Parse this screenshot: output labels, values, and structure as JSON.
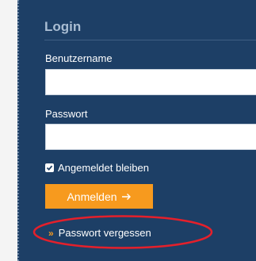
{
  "login": {
    "title": "Login",
    "username_label": "Benutzername",
    "username_value": "",
    "password_label": "Passwort",
    "password_value": "",
    "remember_label": "Angemeldet bleiben",
    "remember_checked": true,
    "submit_label": "Anmelden",
    "submit_icon": "arrow-right-icon",
    "forgot_label": "Passwort vergessen",
    "forgot_icon": "double-chevron-right-icon"
  },
  "annotation": {
    "highlight_color": "#e4202b",
    "highlight_target": "forgot-password-link"
  },
  "colors": {
    "panel_bg": "#1d3f66",
    "accent": "#f79a1e",
    "title": "#a9bdd3"
  }
}
